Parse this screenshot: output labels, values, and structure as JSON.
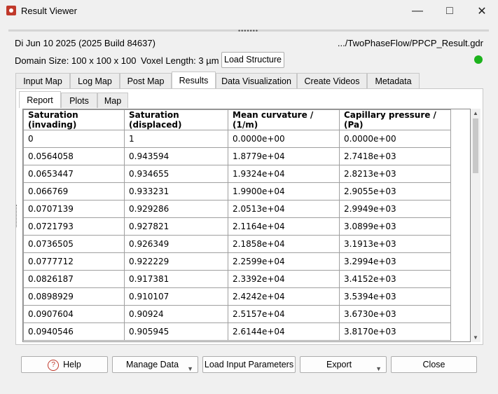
{
  "window": {
    "title": "Result Viewer",
    "min_icon": "minimize-icon",
    "max_icon": "maximize-icon",
    "close_icon": "close-icon"
  },
  "info": {
    "build": "Di Jun 10 2025 (2025 Build 84637)",
    "path": ".../TwoPhaseFlow/PPCP_Result.gdr",
    "domain": "Domain Size: 100 x 100 x 100",
    "voxel": "Voxel Length: 3 µm",
    "load_structure": "Load Structure",
    "status_color": "#1db31d"
  },
  "tabs": [
    "Input Map",
    "Log Map",
    "Post Map",
    "Results",
    "Data Visualization",
    "Create Videos",
    "Metadata"
  ],
  "active_tab": "Results",
  "subtabs": [
    "Report",
    "Plots",
    "Map"
  ],
  "active_subtab": "Report",
  "table": {
    "headers": [
      "Saturation (invading)",
      "Saturation (displaced)",
      "Mean curvature / (1/m)",
      "Capillary pressure / (Pa)"
    ],
    "rows": [
      [
        "0",
        "1",
        "0.0000e+00",
        "0.0000e+00"
      ],
      [
        "0.0564058",
        "0.943594",
        "1.8779e+04",
        "2.7418e+03"
      ],
      [
        "0.0653447",
        "0.934655",
        "1.9324e+04",
        "2.8213e+03"
      ],
      [
        "0.066769",
        "0.933231",
        "1.9900e+04",
        "2.9055e+03"
      ],
      [
        "0.0707139",
        "0.929286",
        "2.0513e+04",
        "2.9949e+03"
      ],
      [
        "0.0721793",
        "0.927821",
        "2.1164e+04",
        "3.0899e+03"
      ],
      [
        "0.0736505",
        "0.926349",
        "2.1858e+04",
        "3.1913e+03"
      ],
      [
        "0.0777712",
        "0.922229",
        "2.2599e+04",
        "3.2994e+03"
      ],
      [
        "0.0826187",
        "0.917381",
        "2.3392e+04",
        "3.4152e+03"
      ],
      [
        "0.0898929",
        "0.910107",
        "2.4242e+04",
        "3.5394e+03"
      ],
      [
        "0.0907604",
        "0.90924",
        "2.5157e+04",
        "3.6730e+03"
      ],
      [
        "0.0940546",
        "0.905945",
        "2.6144e+04",
        "3.8170e+03"
      ]
    ]
  },
  "buttons": {
    "help": "Help",
    "manage_data": "Manage Data",
    "load_input": "Load Input Parameters",
    "export": "Export",
    "close": "Close"
  }
}
